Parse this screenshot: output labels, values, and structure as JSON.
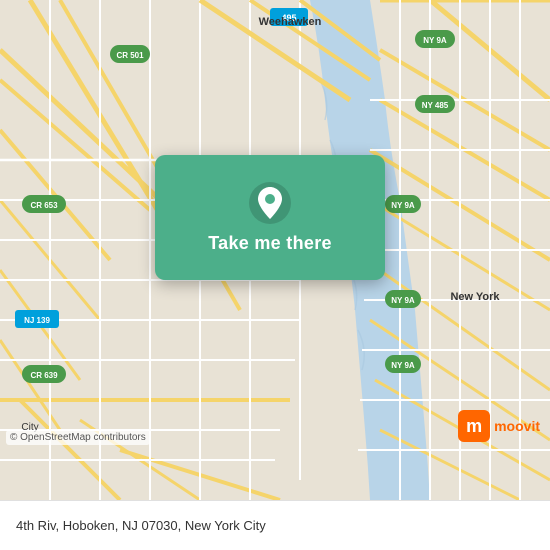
{
  "map": {
    "background_color": "#ddd8c8",
    "water_color": "#b8d4e8",
    "road_color": "#ffffff",
    "yellow_road_color": "#f5d56a"
  },
  "card": {
    "background_color": "#4CAF8A",
    "button_label": "Take me there",
    "pin_color": "#ffffff"
  },
  "bottom_bar": {
    "location_text": "4th Riv, Hoboken, NJ 07030, New York City"
  },
  "copyright": {
    "text": "© OpenStreetMap contributors"
  },
  "moovit": {
    "label": "moovit"
  }
}
